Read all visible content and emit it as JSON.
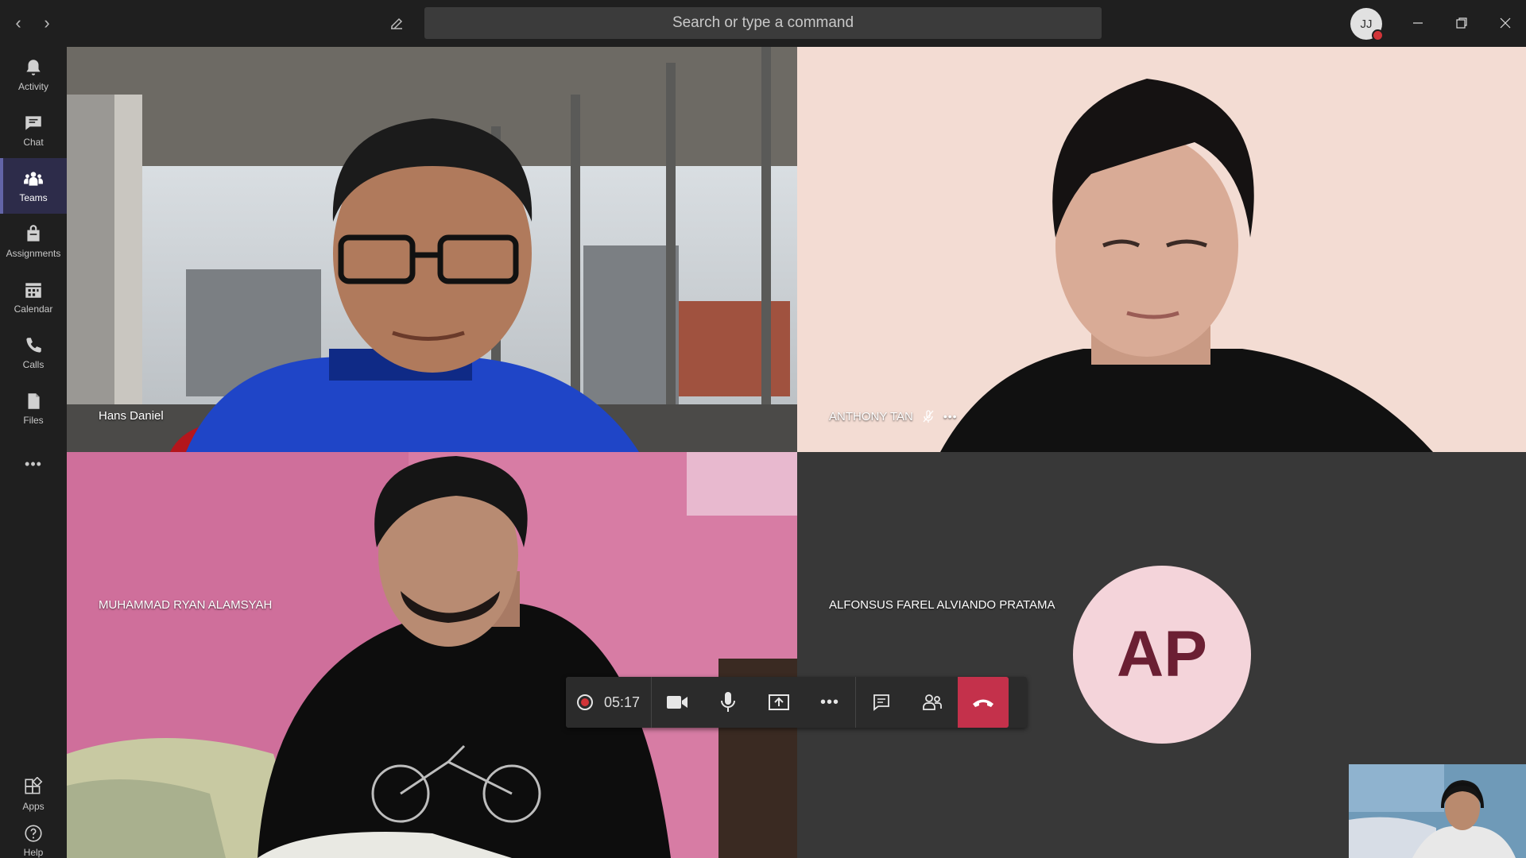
{
  "titlebar": {
    "search_placeholder": "Search or type a command",
    "avatar_initials": "JJ"
  },
  "rail": {
    "items": [
      {
        "label": "Activity",
        "icon": "bell-icon"
      },
      {
        "label": "Chat",
        "icon": "chat-icon"
      },
      {
        "label": "Teams",
        "icon": "teams-icon",
        "active": true
      },
      {
        "label": "Assignments",
        "icon": "assignments-icon"
      },
      {
        "label": "Calendar",
        "icon": "calendar-icon"
      },
      {
        "label": "Calls",
        "icon": "phone-icon"
      },
      {
        "label": "Files",
        "icon": "files-icon"
      }
    ],
    "more_label": "•••",
    "bottom": [
      {
        "label": "Apps",
        "icon": "apps-icon"
      },
      {
        "label": "Help",
        "icon": "help-icon"
      }
    ]
  },
  "participants": {
    "p1": {
      "name": "Hans Daniel"
    },
    "p2": {
      "name": "ANTHONY TAN"
    },
    "p3": {
      "name": "MUHAMMAD RYAN ALAMSYAH"
    },
    "p4": {
      "name": "ALFONSUS FAREL ALVIANDO PRATAMA",
      "initials": "AP"
    }
  },
  "controls": {
    "timer": "05:17",
    "more_label": "•••"
  },
  "colors": {
    "accent": "#6264a7",
    "hangup": "#c4314b",
    "avatar_bg": "#f4d4da",
    "avatar_fg": "#6b1f33"
  }
}
